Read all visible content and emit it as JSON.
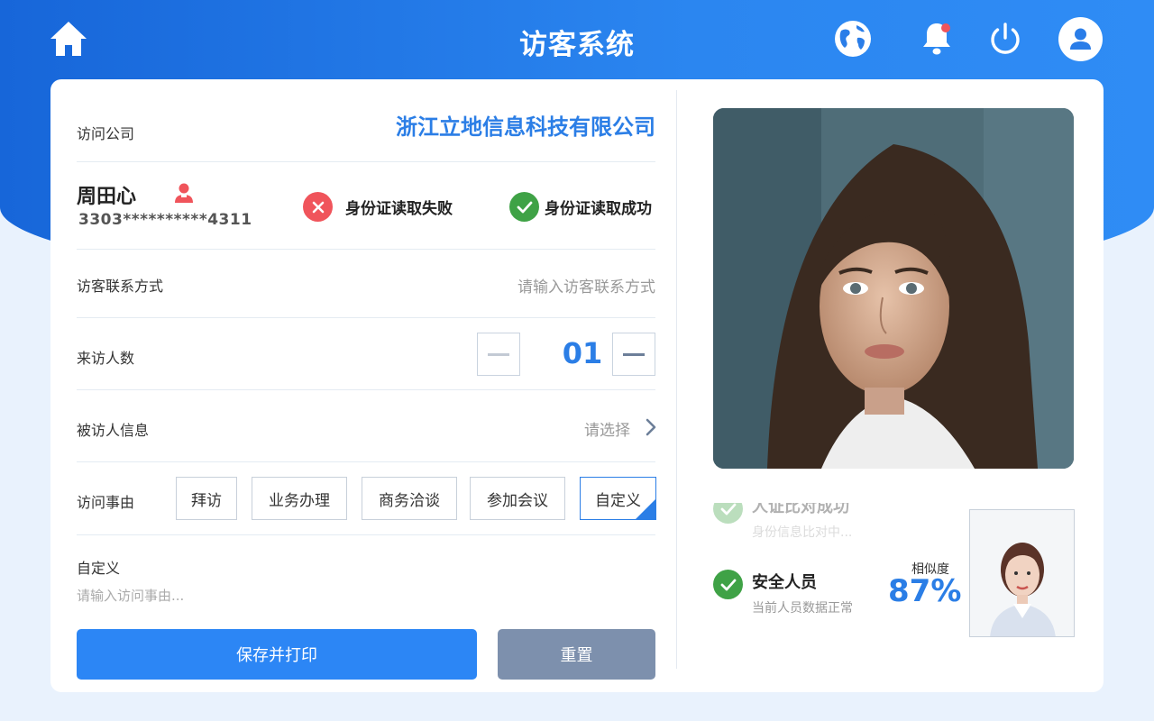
{
  "app": {
    "title": "访客系统"
  },
  "header": {
    "icons": [
      "home-icon",
      "globe-icon",
      "bell-icon",
      "power-icon",
      "avatar-icon"
    ],
    "notification_dot": true
  },
  "form": {
    "company": {
      "label": "访问公司",
      "value": "浙江立地信息科技有限公司"
    },
    "visitor": {
      "name": "周田心",
      "id_number": "3303**********4311"
    },
    "id_status": {
      "fail": "身份证读取失败",
      "success": "身份证读取成功"
    },
    "contact": {
      "label": "访客联系方式",
      "placeholder": "请输入访客联系方式"
    },
    "visitor_count": {
      "label": "来访人数",
      "value": "01"
    },
    "host": {
      "label": "被访人信息",
      "placeholder": "请选择"
    },
    "reason": {
      "label": "访问事由",
      "options": [
        "拜访",
        "业务办理",
        "商务洽谈",
        "参加会议",
        "自定义"
      ],
      "selected": "自定义"
    },
    "custom": {
      "label": "自定义",
      "placeholder": "请输入访问事由..."
    },
    "save_label": "保存并打印",
    "reset_label": "重置"
  },
  "verification": {
    "face_match": {
      "title": "人证比对成功",
      "subtitle": "身份信息比对中..."
    },
    "security": {
      "title": "安全人员",
      "subtitle": "当前人员数据正常"
    },
    "similarity_label": "相似度",
    "similarity_value": "87%"
  },
  "colors": {
    "accent": "#2b7ee6",
    "header_start": "#1766d9",
    "header_end": "#2f8cf5",
    "success": "#3fa246",
    "error": "#f0545b",
    "reset_button": "#7d90ad"
  }
}
